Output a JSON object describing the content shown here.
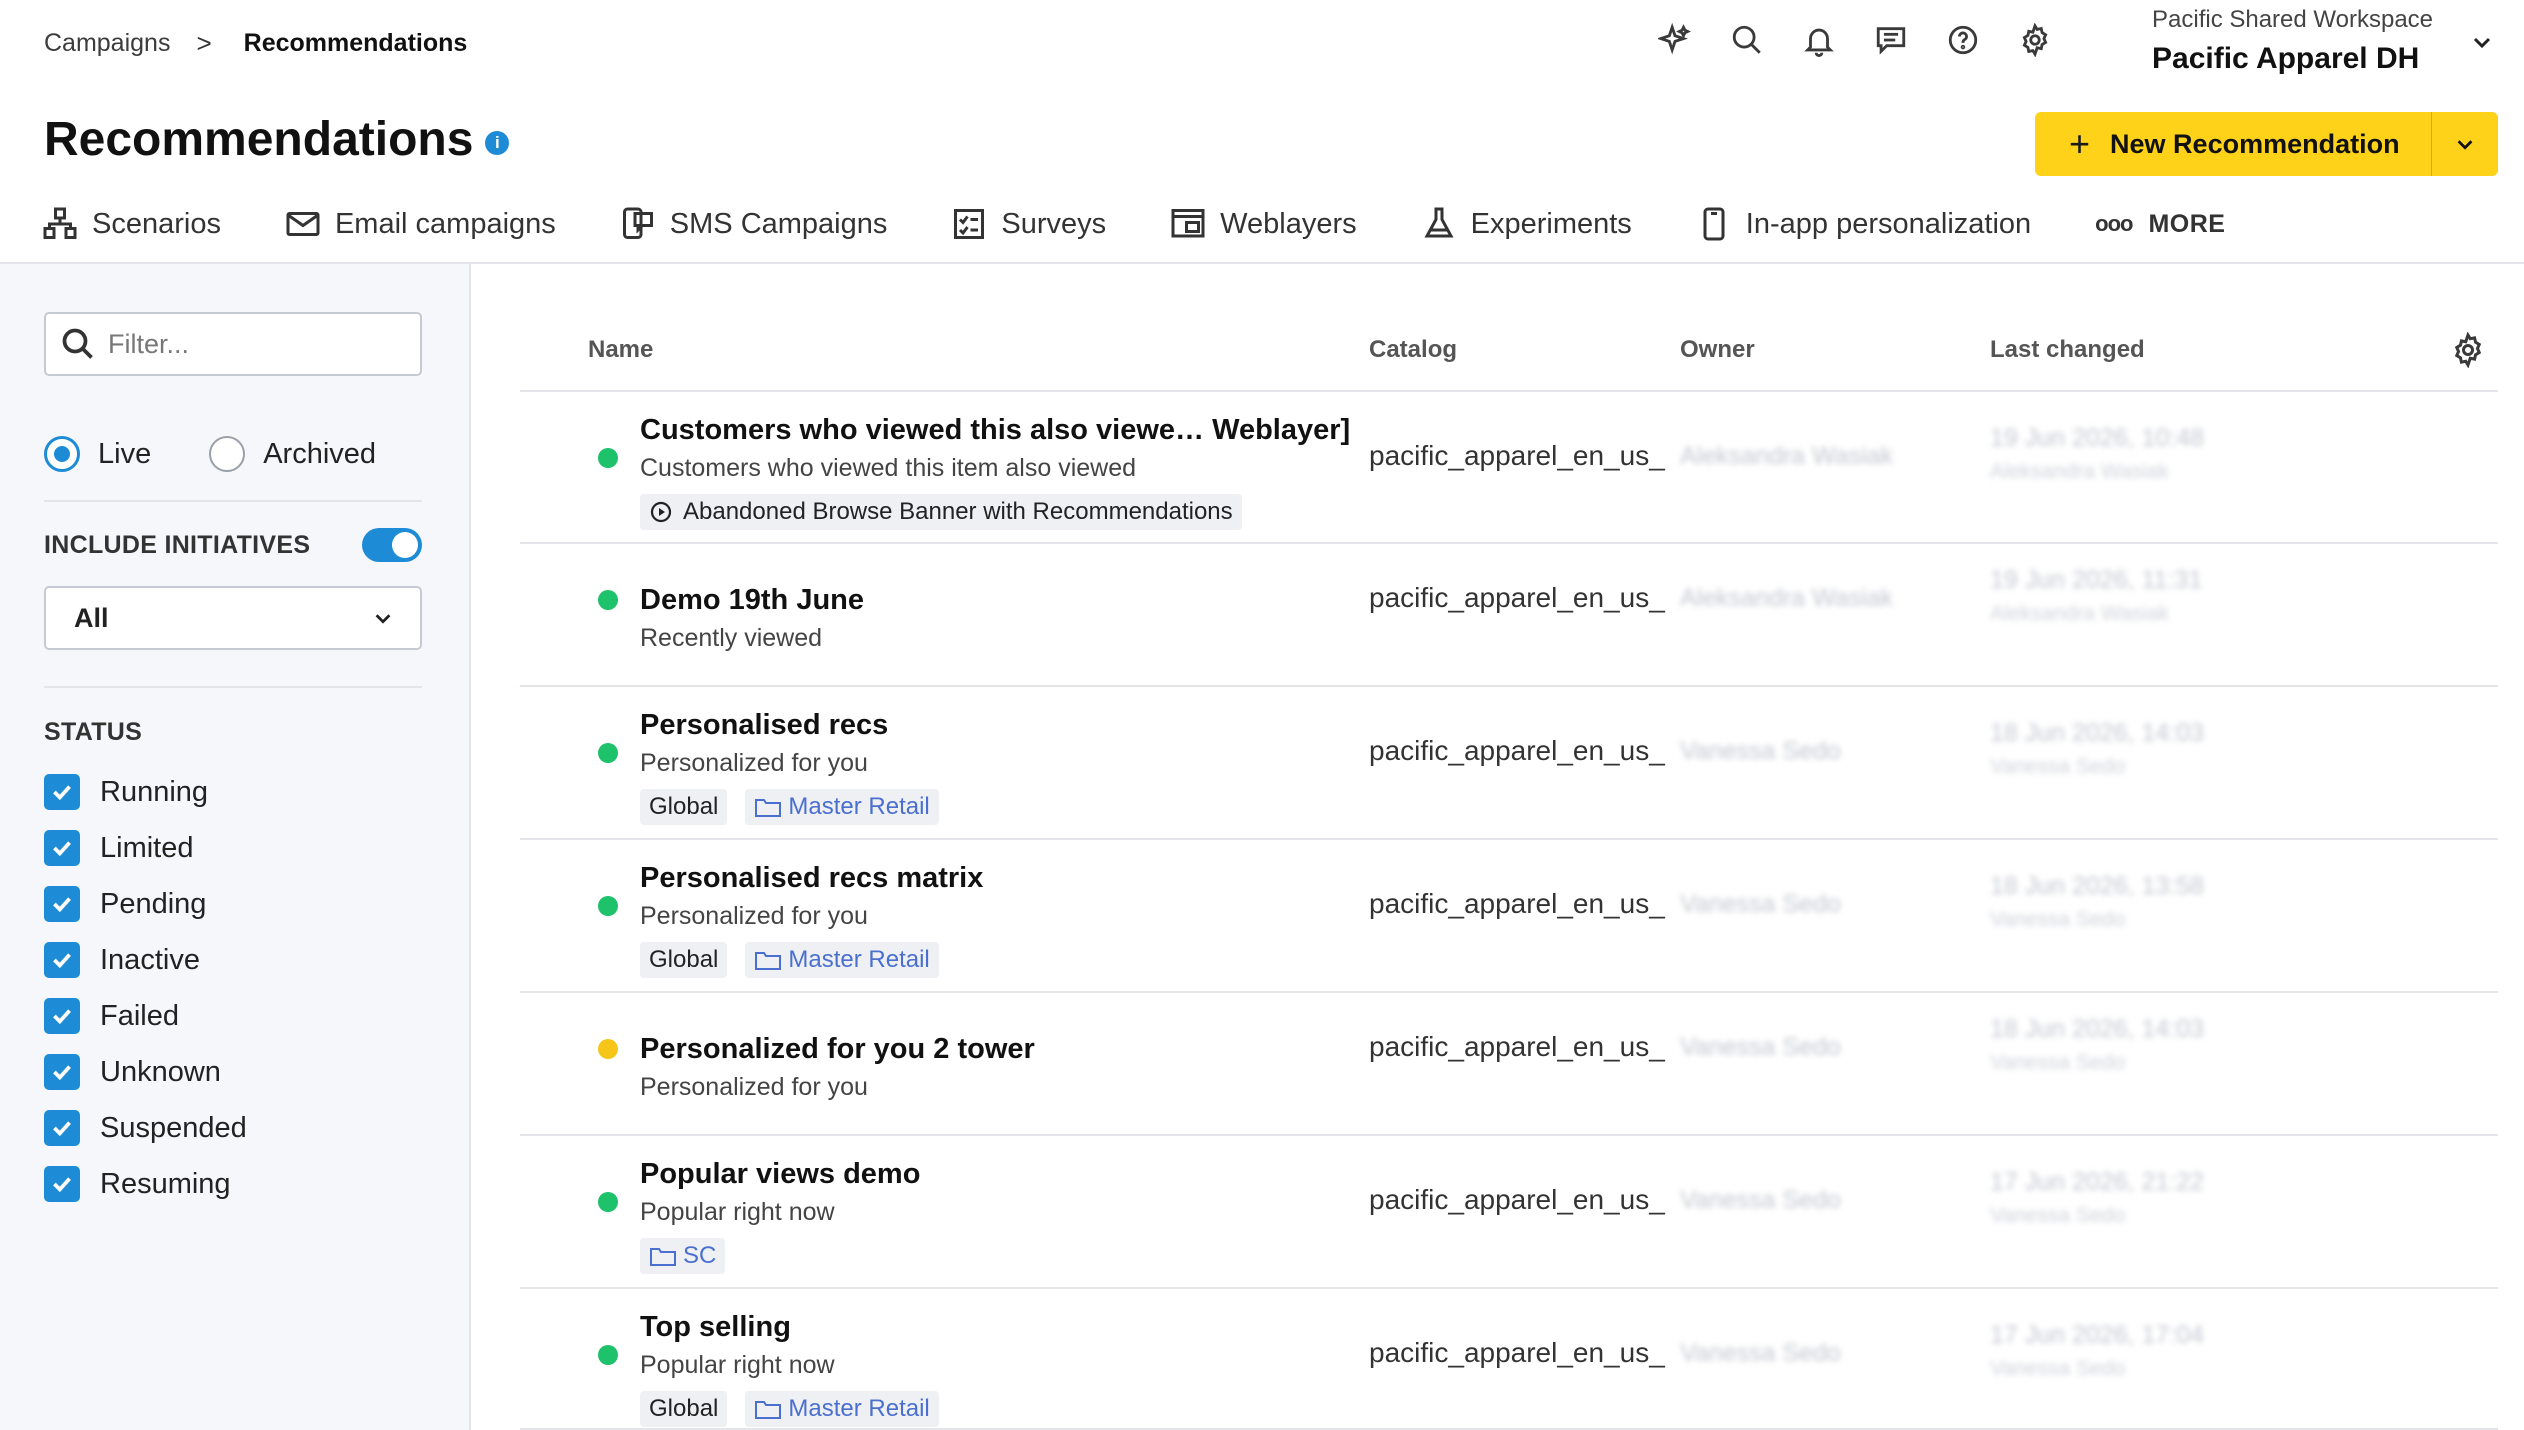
{
  "breadcrumb": {
    "parent": "Campaigns",
    "separator": ">",
    "current": "Recommendations"
  },
  "workspace": {
    "subtitle": "Pacific Shared Workspace",
    "name": "Pacific Apparel DH"
  },
  "header": {
    "title": "Recommendations",
    "info": "i",
    "new_button": {
      "plus": "+",
      "label": "New Recommendation"
    },
    "icons": [
      "sparkle-icon",
      "search-icon",
      "bell-icon",
      "chat-icon",
      "help-icon",
      "gear-icon"
    ]
  },
  "tabs": [
    {
      "label": "Scenarios",
      "icon": "scenarios-icon"
    },
    {
      "label": "Email campaigns",
      "icon": "mail-icon"
    },
    {
      "label": "SMS Campaigns",
      "icon": "sms-icon"
    },
    {
      "label": "Surveys",
      "icon": "survey-icon"
    },
    {
      "label": "Weblayers",
      "icon": "weblayer-icon"
    },
    {
      "label": "Experiments",
      "icon": "flask-icon"
    },
    {
      "label": "In-app personalization",
      "icon": "mobile-icon"
    },
    {
      "label": "MORE",
      "icon": "more-icon",
      "dots": "ooo"
    }
  ],
  "sidebar": {
    "filter_placeholder": "Filter...",
    "radio_live": "Live",
    "radio_archived": "Archived",
    "include_initiatives": "INCLUDE INITIATIVES",
    "select_value": "All",
    "status_header": "STATUS",
    "statuses": [
      "Running",
      "Limited",
      "Pending",
      "Inactive",
      "Failed",
      "Unknown",
      "Suspended",
      "Resuming"
    ]
  },
  "table": {
    "columns": {
      "name": "Name",
      "catalog": "Catalog",
      "owner": "Owner",
      "last_changed": "Last changed"
    },
    "rows": [
      {
        "name": "Customers who viewed this also viewe… Weblayer]",
        "sub": "Customers who viewed this item also viewed",
        "status": "green",
        "tags": [
          {
            "type": "scenario",
            "label": "Abandoned Browse Banner with Recommendations"
          }
        ],
        "catalog": "pacific_apparel_en_us_",
        "owner": "Aleksandra Wasiak",
        "changed": "19 Jun 2026, 10:48",
        "changed_by": "Aleksandra Wasiak"
      },
      {
        "name": "Demo 19th June",
        "sub": "Recently viewed",
        "status": "green",
        "tags": [],
        "catalog": "pacific_apparel_en_us_",
        "owner": "Aleksandra Wasiak",
        "changed": "19 Jun 2026, 11:31",
        "changed_by": "Aleksandra Wasiak"
      },
      {
        "name": "Personalised recs",
        "sub": "Personalized for you",
        "status": "green",
        "tags": [
          {
            "type": "plain",
            "label": "Global"
          },
          {
            "type": "folder",
            "label": "Master Retail"
          }
        ],
        "catalog": "pacific_apparel_en_us_",
        "owner": "Vanessa Sedo",
        "changed": "18 Jun 2026, 14:03",
        "changed_by": "Vanessa Sedo"
      },
      {
        "name": "Personalised recs matrix",
        "sub": "Personalized for you",
        "status": "green",
        "tags": [
          {
            "type": "plain",
            "label": "Global"
          },
          {
            "type": "folder",
            "label": "Master Retail"
          }
        ],
        "catalog": "pacific_apparel_en_us_",
        "owner": "Vanessa Sedo",
        "changed": "18 Jun 2026, 13:58",
        "changed_by": "Vanessa Sedo"
      },
      {
        "name": "Personalized for you 2 tower",
        "sub": "Personalized for you",
        "status": "yellow",
        "tags": [],
        "catalog": "pacific_apparel_en_us_",
        "owner": "Vanessa Sedo",
        "changed": "18 Jun 2026, 14:03",
        "changed_by": "Vanessa Sedo"
      },
      {
        "name": "Popular views demo",
        "sub": "Popular right now",
        "status": "green",
        "tags": [
          {
            "type": "folder",
            "label": "SC"
          }
        ],
        "catalog": "pacific_apparel_en_us_",
        "owner": "Vanessa Sedo",
        "changed": "17 Jun 2026, 21:22",
        "changed_by": "Vanessa Sedo"
      },
      {
        "name": "Top selling",
        "sub": "Popular right now",
        "status": "green",
        "tags": [
          {
            "type": "plain",
            "label": "Global"
          },
          {
            "type": "folder",
            "label": "Master Retail"
          }
        ],
        "catalog": "pacific_apparel_en_us_",
        "owner": "Vanessa Sedo",
        "changed": "17 Jun 2026, 17:04",
        "changed_by": "Vanessa Sedo"
      }
    ]
  },
  "colors": {
    "accent": "#1d8bd6",
    "cta": "#ffd21a",
    "live": "#1dc26a",
    "warn": "#f5c518"
  }
}
